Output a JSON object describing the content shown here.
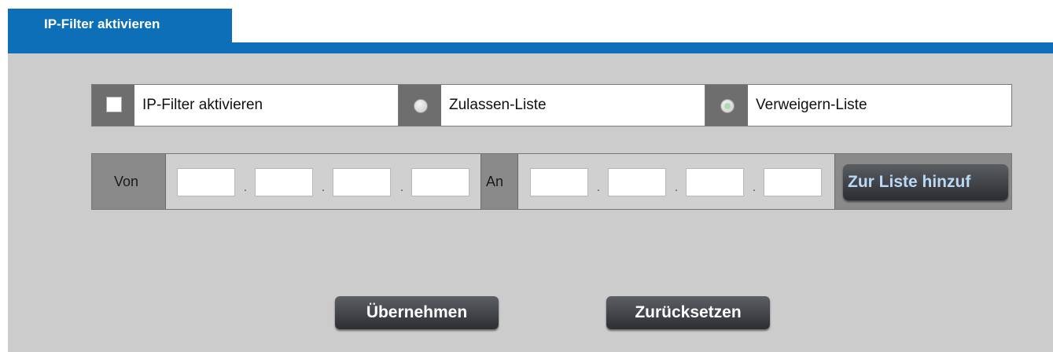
{
  "tab": {
    "label": "IP-Filter aktivieren"
  },
  "options": {
    "enable_label": "IP-Filter aktivieren",
    "enable_checked": false,
    "allow_label": "Zulassen-Liste",
    "deny_label": "Verweigern-Liste",
    "selected_list": "deny"
  },
  "range": {
    "from_label": "Von",
    "to_label": "An",
    "separator": ".",
    "from_octets": [
      "",
      "",
      "",
      ""
    ],
    "to_octets": [
      "",
      "",
      "",
      ""
    ],
    "add_button": "Zur Liste hinzuf"
  },
  "actions": {
    "apply": "Übernehmen",
    "reset": "Zurücksetzen"
  },
  "colors": {
    "accent": "#0d6fb8",
    "panel_bg": "#cccccc",
    "label_cell": "#8a8a8a"
  }
}
